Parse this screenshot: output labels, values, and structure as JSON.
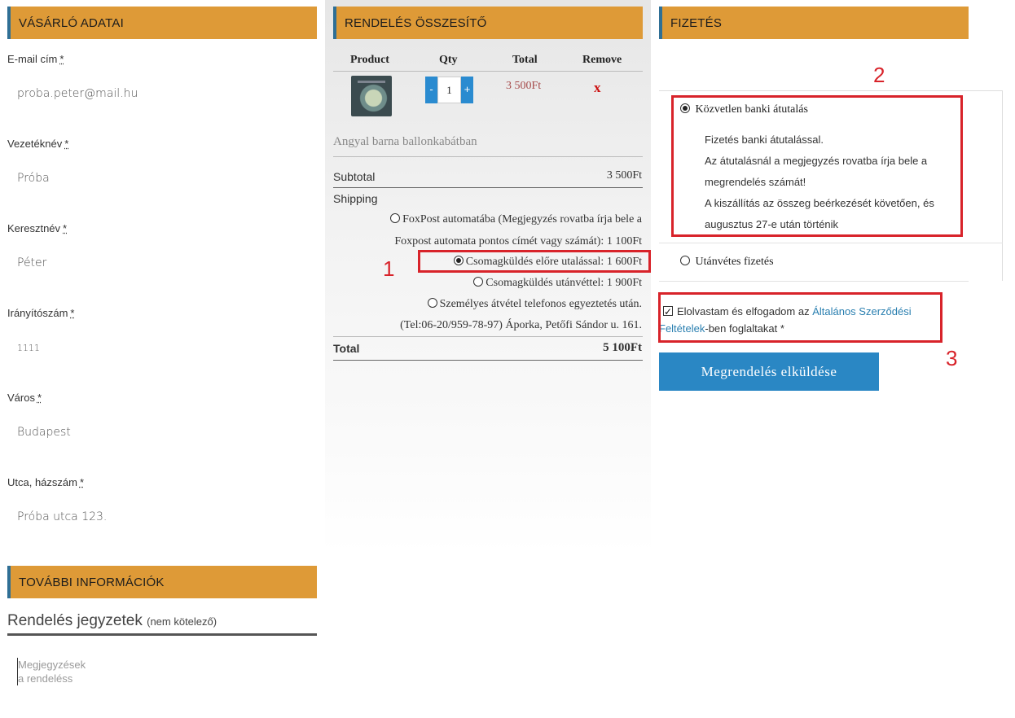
{
  "customer": {
    "header": "VÁSÁRLÓ ADATAI",
    "required_mark": "*",
    "fields": [
      {
        "label": "E-mail cím",
        "value": "proba.peter@mail.hu"
      },
      {
        "label": "Vezetéknév",
        "value": "Próba"
      },
      {
        "label": "Keresztnév",
        "value": "Péter"
      },
      {
        "label": "Irányítószám",
        "value": "1111"
      },
      {
        "label": "Város",
        "value": "Budapest"
      },
      {
        "label": "Utca, házszám",
        "value": "Próba utca 123."
      }
    ]
  },
  "additional": {
    "header": "TOVÁBBI INFORMÁCIÓK",
    "notes_title": "Rendelés jegyzetek",
    "notes_optional": "(nem kötelező)",
    "notes_placeholder": "Megjegyzések a rendeléss"
  },
  "summary": {
    "header": "RENDELÉS ÖSSZESÍTŐ",
    "columns": [
      "Product",
      "Qty",
      "Total",
      "Remove"
    ],
    "item": {
      "qty_minus": "-",
      "qty": "1",
      "qty_plus": "+",
      "total": "3 500Ft",
      "remove": "x",
      "name": "Angyal barna ballonkabátban"
    },
    "subtotal_label": "Subtotal",
    "subtotal_value": "3 500Ft",
    "shipping_label": "Shipping",
    "shipping_options": [
      {
        "line1": "FoxPost automatába (Megjegyzés rovatba írja bele a",
        "line2": "Foxpost automata pontos címét vagy számát): 1 100Ft",
        "selected": false
      },
      {
        "line1": "Csomagküldés előre utalással: 1 600Ft",
        "selected": true
      },
      {
        "line1": "Csomagküldés utánvéttel: 1 900Ft",
        "selected": false
      },
      {
        "line1": "Személyes átvétel telefonos egyeztetés után.",
        "line2": "(Tel:06-20/959-78-97) Áporka, Petőfi Sándor u. 161.",
        "selected": false
      }
    ],
    "total_label": "Total",
    "total_value": "5 100Ft"
  },
  "payment": {
    "header": "FIZETÉS",
    "options": [
      {
        "label": "Közvetlen banki átutalás",
        "selected": true
      },
      {
        "label": "Utánvétes fizetés",
        "selected": false
      }
    ],
    "bank_desc": [
      "Fizetés banki átutalással.",
      "Az átutalásnál a megjegyzés rovatba írja bele a",
      "megrendelés számát!",
      "A kiszállítás az összeg beérkezését követően, és",
      "augusztus 27-e után történik"
    ],
    "terms_prefix": "Elolvastam és elfogadom az ",
    "terms_link": "Általános Szerződési Feltételek",
    "terms_suffix": "-ben foglaltakat *",
    "submit": "Megrendelés elküldése"
  },
  "annotations": {
    "marks": [
      "1",
      "2",
      "3"
    ],
    "color": "#d8232a"
  },
  "colors": {
    "header_bg": "#de9a37",
    "header_accent": "#2f6f95",
    "button_bg": "#2a87c4",
    "qty_button_bg": "#2a8bd0",
    "price_color": "#a64b4b",
    "remove_color": "#cc1111",
    "link_color": "#2a7fb0"
  }
}
